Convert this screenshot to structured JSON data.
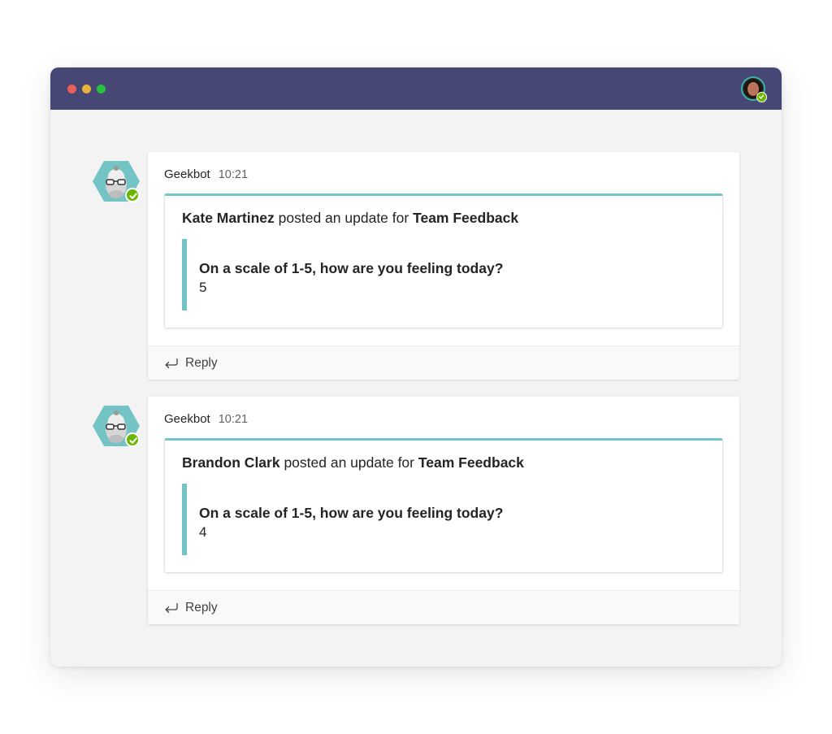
{
  "window": {
    "titlebar_color": "#464775",
    "accent_color": "#74c4c6",
    "status_color": "#6bb700"
  },
  "user": {
    "avatar_icon": "user-avatar",
    "status": "available"
  },
  "messages": [
    {
      "sender": "Geekbot",
      "time": "10:21",
      "author": "Kate Martinez",
      "posted_text": "posted an update for",
      "team": "Team Feedback",
      "question": "On a scale of 1-5, how are you feeling today?",
      "answer": "5",
      "reply_label": "Reply"
    },
    {
      "sender": "Geekbot",
      "time": "10:21",
      "author": "Brandon Clark",
      "posted_text": "posted an update for",
      "team": "Team Feedback",
      "question": "On a scale of 1-5, how are you feeling today?",
      "answer": "4",
      "reply_label": "Reply"
    }
  ]
}
